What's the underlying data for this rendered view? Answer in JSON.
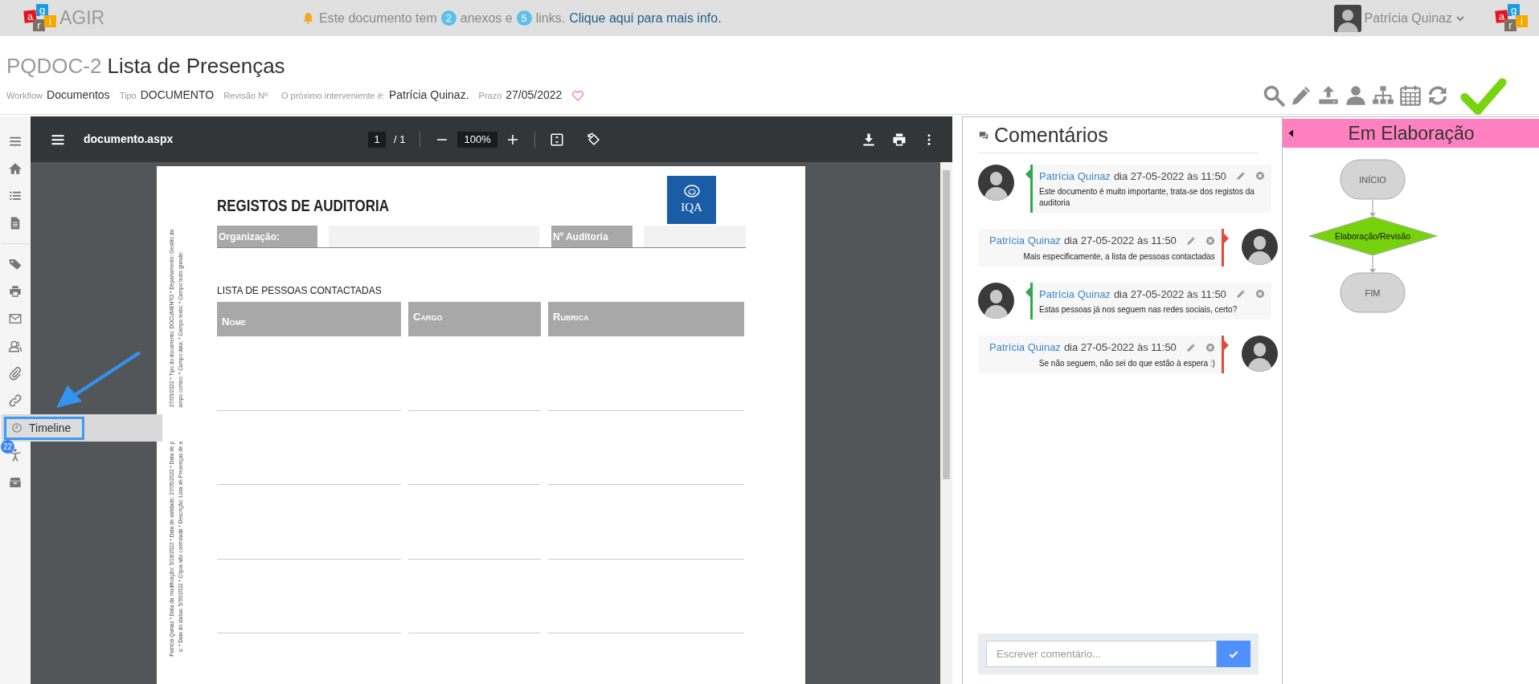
{
  "top_bar": {
    "logo": [
      {
        "letter": "a",
        "color": "#e8141b"
      },
      {
        "letter": "g",
        "color": "#1e9be0"
      },
      {
        "letter": "r",
        "color": "#7d7067"
      },
      {
        "letter": "i",
        "color": "#f6a800"
      }
    ],
    "app_name": "AGIR",
    "notice": {
      "before": "Este documento tem",
      "attachments": "2",
      "middle": "anexos e",
      "links": "5",
      "after": "links.",
      "link": "Clique aqui para mais info."
    },
    "user": {
      "name": "Patrícia Quinaz"
    },
    "right_logo": [
      {
        "letter": "a",
        "color": "#e8141b"
      },
      {
        "letter": "g",
        "color": "#1e9be0"
      },
      {
        "letter": "r",
        "color": "#7d7067"
      },
      {
        "letter": "i",
        "color": "#f6a800"
      }
    ]
  },
  "header": {
    "code": "PQDOC-2",
    "title": "Lista de Presenças",
    "meta": [
      {
        "label": "Workflow",
        "value": "Documentos"
      },
      {
        "label": "Tipo",
        "value": "DOCUMENTO"
      },
      {
        "label": "Revisão Nº"
      },
      {
        "label": "O próximo interveniente é:",
        "value": "Patrícia Quinaz."
      },
      {
        "label": "Prazo",
        "value": "27/05/2022"
      }
    ],
    "favorite": false,
    "actions": [
      {
        "kind": "search"
      },
      {
        "kind": "edit"
      },
      {
        "kind": "upload"
      },
      {
        "kind": "user"
      },
      {
        "kind": "hierarchy"
      },
      {
        "kind": "calendar"
      },
      {
        "kind": "refresh"
      },
      {
        "kind": "approve"
      }
    ]
  },
  "sidebar": {
    "items": [
      {
        "kind": "menu"
      },
      {
        "kind": "home"
      },
      {
        "kind": "list"
      },
      {
        "kind": "document"
      },
      {
        "kind": "divider"
      },
      {
        "kind": "tag"
      },
      {
        "kind": "print"
      },
      {
        "kind": "mail"
      },
      {
        "kind": "users"
      },
      {
        "kind": "attachment"
      },
      {
        "kind": "link"
      },
      {
        "kind": "timeline",
        "label": "Timeline",
        "highlighted": true
      },
      {
        "kind": "accessibility",
        "badge": "22"
      },
      {
        "kind": "archive"
      }
    ]
  },
  "pdf_viewer": {
    "file_name": "documento.aspx",
    "page": "1",
    "page_of": "/ 1",
    "zoom": "100%",
    "document": {
      "title": "REGISTOS DE AUDITORIA",
      "logo_text": "IQA",
      "fields": [
        {
          "label": "Organização:"
        },
        {
          "label": "Nº Auditoria"
        }
      ],
      "section": "LISTA DE PESSOAS CONTACTADAS",
      "columns": [
        "Nome",
        "Cargo",
        "Rubrica"
      ],
      "margin_lines": [
        {
          "upper": "27/05/2022 * Tipo do documento: DOCUMENTO * Departamento: Gestão da",
          "lower": "Patrícia Quinaz * Data da modificação: 5/18/2022 * Data de validade: 27/05/2022 * Data de p"
        },
        {
          "upper": "ampo combo: * Campo data: * Campo texto: * Campo texto grande:",
          "lower": "s: * Data do status: 5/30/2022 * Cópia não controlada * Descrição: Lista de Presenças de a"
        }
      ]
    }
  },
  "comments": {
    "title": "Comentários",
    "items": [
      {
        "kind": "left",
        "color": "#2fa84f",
        "author": "Patrícia Quinaz",
        "date": "dia 27-05-2022 às 11:50",
        "text": "Este documento é muito importante, trata-se dos registos da auditoria"
      },
      {
        "kind": "right",
        "color": "#e04b3a",
        "author": "Patrícia Quinaz",
        "date": "dia 27-05-2022 às 11:50",
        "text": "Mais especificamente, a lista de pessoas contactadas"
      },
      {
        "kind": "left",
        "color": "#2fa84f",
        "author": "Patrícia Quinaz",
        "date": "dia 27-05-2022 às 11:50",
        "text": "Estas pessoas já nos seguem nas redes sociais, certo?"
      },
      {
        "kind": "right",
        "color": "#e04b3a",
        "author": "Patrícia Quinaz",
        "date": "dia 27-05-2022 às 11:50",
        "text": "Se não seguem, não sei do que estão à espera :)"
      }
    ],
    "input": {
      "placeholder": "Escrever comentário..."
    }
  },
  "workflow": {
    "status": "Em Elaboração",
    "color": "#ff80c0",
    "nodes": [
      {
        "kind": "terminal",
        "label": "INÍCIO",
        "current": false
      },
      {
        "kind": "step",
        "label": "Elaboração/Revisão",
        "current": true
      },
      {
        "kind": "terminal",
        "label": "FIM",
        "current": false
      }
    ]
  }
}
